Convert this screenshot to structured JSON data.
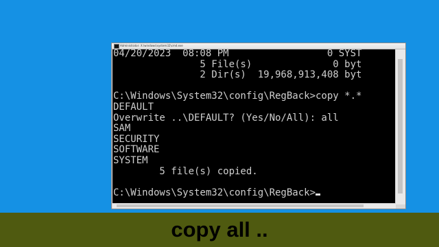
{
  "window": {
    "title": "Administrator: X:\\windows\\system32\\cmd.exe"
  },
  "console": {
    "lines": [
      "04/20/2023  08:08 PM                 0 SYST",
      "               5 File(s)              0 byt",
      "               2 Dir(s)  19,968,913,408 byt",
      "",
      "C:\\Windows\\System32\\config\\RegBack>copy *.*",
      "DEFAULT",
      "Overwrite ..\\DEFAULT? (Yes/No/All): all",
      "SAM",
      "SECURITY",
      "SOFTWARE",
      "SYSTEM",
      "        5 file(s) copied.",
      "",
      "C:\\Windows\\System32\\config\\RegBack>"
    ]
  },
  "caption": {
    "text": "copy all .."
  }
}
